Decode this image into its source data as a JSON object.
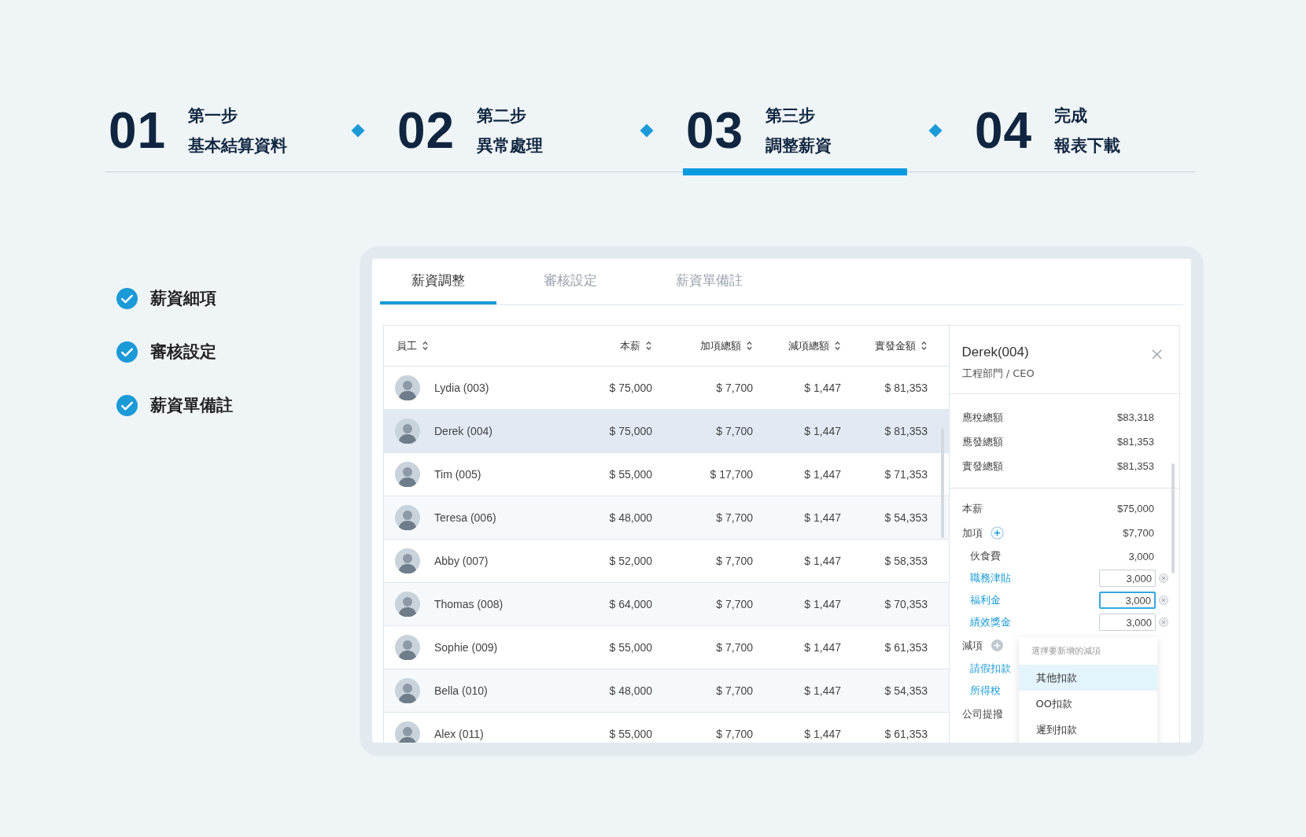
{
  "steps": [
    {
      "number": "01",
      "title": "第一步",
      "subtitle": "基本結算資料",
      "selected": false
    },
    {
      "number": "02",
      "title": "第二步",
      "subtitle": "異常處理",
      "selected": false
    },
    {
      "number": "03",
      "title": "第三步",
      "subtitle": "調整薪資",
      "selected": true
    },
    {
      "number": "04",
      "title": "完成",
      "subtitle": "報表下載",
      "selected": false
    }
  ],
  "checklist": [
    {
      "label": "薪資細項",
      "checked": true
    },
    {
      "label": "審核設定",
      "checked": true
    },
    {
      "label": "薪資單備註",
      "checked": true
    }
  ],
  "tabs": [
    {
      "label": "薪資調整",
      "selected": true
    },
    {
      "label": "審核設定",
      "selected": false
    },
    {
      "label": "薪資單備註",
      "selected": false
    }
  ],
  "table": {
    "columns": [
      "員工",
      "本薪",
      "加項總額",
      "減項總額",
      "實發金額"
    ],
    "rows": [
      {
        "name": "Lydia (003)",
        "base": "$ 75,000",
        "plus": "$ 7,700",
        "minus": "$ 1,447",
        "net": "$ 81,353",
        "selected": false
      },
      {
        "name": "Derek (004)",
        "base": "$ 75,000",
        "plus": "$ 7,700",
        "minus": "$ 1,447",
        "net": "$ 81,353",
        "selected": true
      },
      {
        "name": "Tim (005)",
        "base": "$ 55,000",
        "plus": "$ 17,700",
        "minus": "$ 1,447",
        "net": "$ 71,353",
        "selected": false
      },
      {
        "name": "Teresa (006)",
        "base": "$ 48,000",
        "plus": "$ 7,700",
        "minus": "$ 1,447",
        "net": "$ 54,353",
        "selected": false
      },
      {
        "name": "Abby (007)",
        "base": "$ 52,000",
        "plus": "$ 7,700",
        "minus": "$ 1,447",
        "net": "$ 58,353",
        "selected": false
      },
      {
        "name": "Thomas (008)",
        "base": "$ 64,000",
        "plus": "$ 7,700",
        "minus": "$ 1,447",
        "net": "$ 70,353",
        "selected": false
      },
      {
        "name": "Sophie (009)",
        "base": "$ 55,000",
        "plus": "$ 7,700",
        "minus": "$ 1,447",
        "net": "$ 61,353",
        "selected": false
      },
      {
        "name": "Bella (010)",
        "base": "$ 48,000",
        "plus": "$ 7,700",
        "minus": "$ 1,447",
        "net": "$ 54,353",
        "selected": false
      },
      {
        "name": "Alex (011)",
        "base": "$ 55,000",
        "plus": "$ 7,700",
        "minus": "$ 1,447",
        "net": "$ 61,353",
        "selected": false
      }
    ]
  },
  "detail": {
    "name": "Derek(004)",
    "department": "工程部門 / CEO",
    "summary": [
      {
        "label": "應稅總額",
        "value": "$83,318"
      },
      {
        "label": "應發總額",
        "value": "$81,353"
      },
      {
        "label": "實發總額",
        "value": "$81,353"
      }
    ],
    "base": {
      "label": "本薪",
      "value": "$75,000"
    },
    "additions": {
      "label": "加項",
      "value": "$7,700",
      "items": [
        {
          "kind": "fixed",
          "label": "伙食費",
          "value": "3,000"
        },
        {
          "kind": "input",
          "label": "職務津貼",
          "value": "3,000",
          "focused": false
        },
        {
          "kind": "input",
          "label": "福利金",
          "value": "3,000",
          "focused": true
        },
        {
          "kind": "input",
          "label": "績效獎金",
          "value": "3,000",
          "focused": false
        }
      ]
    },
    "deductions": {
      "label": "減項",
      "items": [
        {
          "label": "請假扣款"
        },
        {
          "label": "所得稅"
        }
      ]
    },
    "company_label": "公司提撥",
    "dropdown": {
      "placeholder": "選擇要新增的減項",
      "options": [
        {
          "label": "其他扣款",
          "selected": true
        },
        {
          "label": "OO扣款",
          "selected": false
        },
        {
          "label": "遲到扣款",
          "selected": false
        }
      ]
    }
  }
}
